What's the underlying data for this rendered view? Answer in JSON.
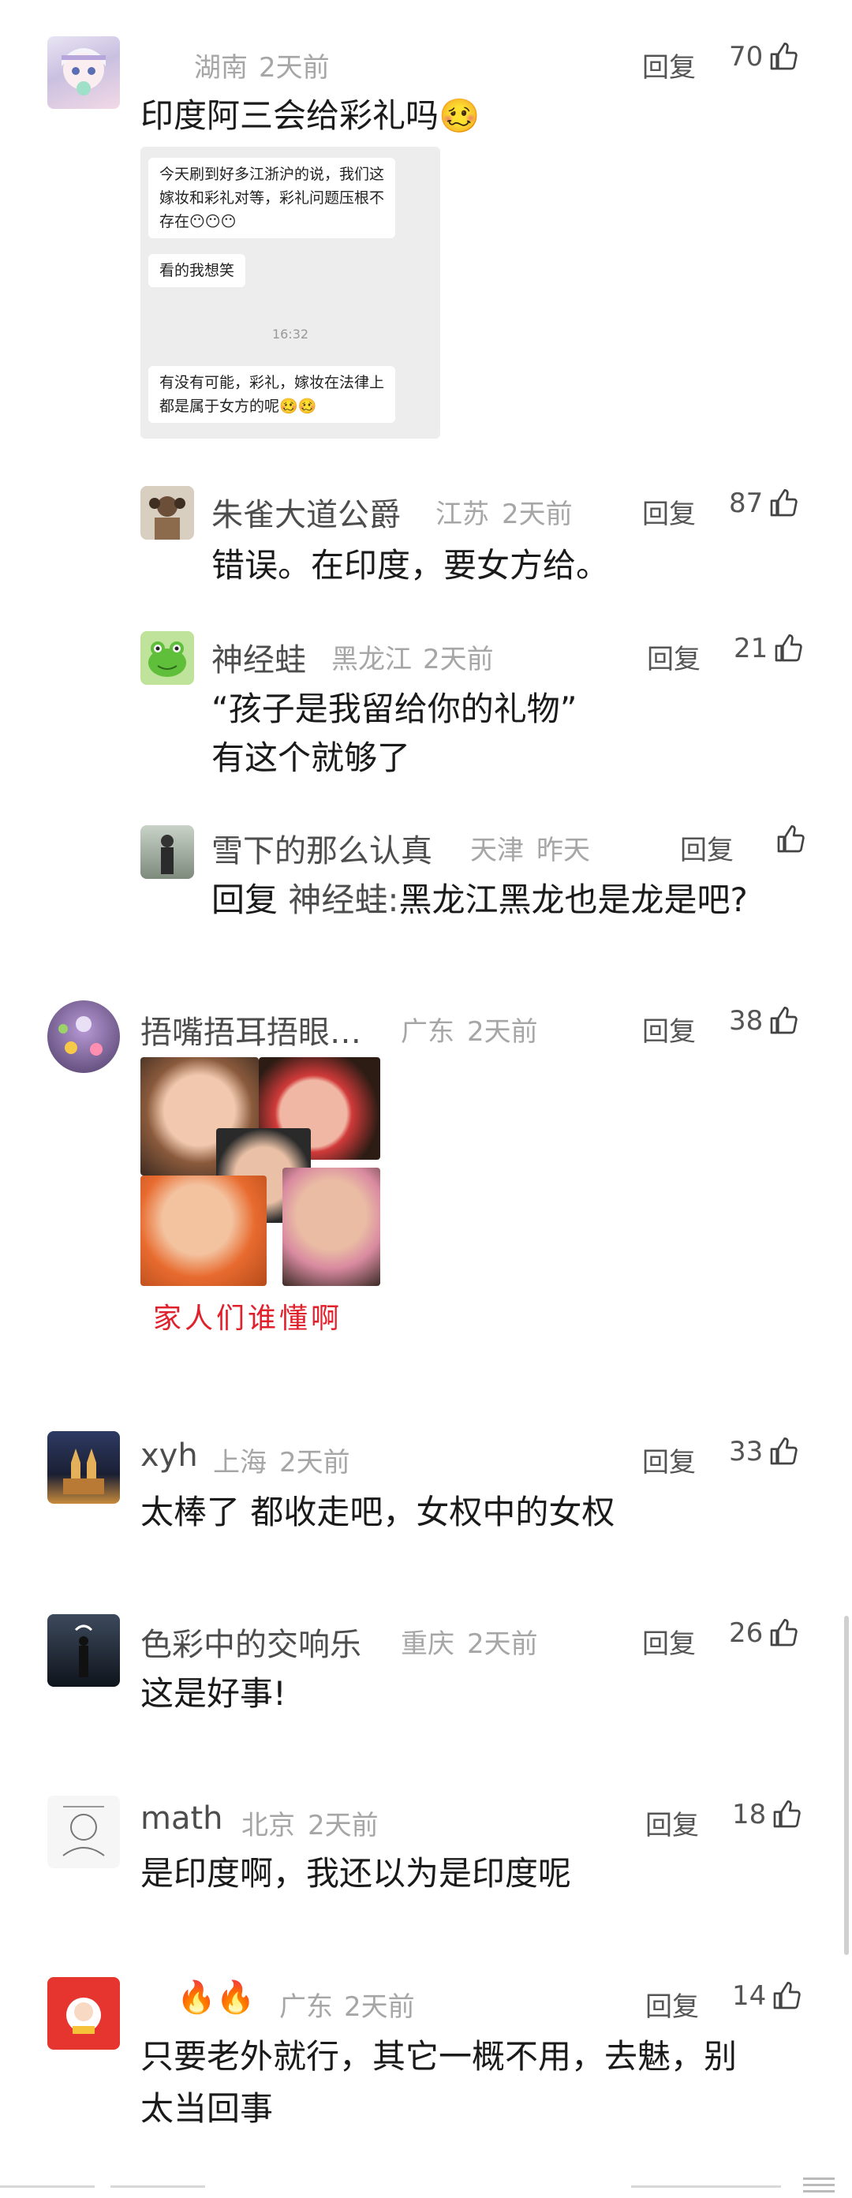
{
  "reply_label": "回复",
  "comments": [
    {
      "name": "",
      "region": "湖南",
      "time": "2天前",
      "likes": "70",
      "text": "印度阿三会给彩礼吗🥴",
      "chat": {
        "bubbles": [
          "今天刷到好多江浙沪的说，我们这",
          "嫁妆和彩礼对等，彩礼问题压根不",
          "存在😶😶😶",
          "看的我想笑",
          "有没有可能，彩礼，嫁妆在法律上",
          "都是属于女方的呢🥴🥴"
        ],
        "time": "16:32"
      }
    },
    {
      "name": "朱雀大道公爵",
      "region": "江苏",
      "time": "2天前",
      "likes": "87",
      "text": "错误。在印度，要女方给。"
    },
    {
      "name": "神经蛙",
      "region": "黑龙江",
      "time": "2天前",
      "likes": "21",
      "lines": [
        "“孩子是我留给你的礼物”",
        "有这个就够了"
      ]
    },
    {
      "name": "雪下的那么认真",
      "region": "天津",
      "time": "昨天",
      "likes": "",
      "reply_prefix": "回复",
      "mention": "神经蛙:",
      "text": "黑龙江黑龙也是龙是吧?"
    },
    {
      "name": "捂嘴捂耳捂眼…",
      "region": "广东",
      "time": "2天前",
      "likes": "38",
      "meme_caption": "家人们谁懂啊"
    },
    {
      "name": "xyh",
      "region": "上海",
      "time": "2天前",
      "likes": "33",
      "text": "太棒了 都收走吧，女权中的女权"
    },
    {
      "name": "色彩中的交响乐",
      "region": "重庆",
      "time": "2天前",
      "likes": "26",
      "text": "这是好事!"
    },
    {
      "name": "math",
      "region": "北京",
      "time": "2天前",
      "likes": "18",
      "text": "是印度啊，我还以为是印度呢"
    },
    {
      "name": "🔥🔥",
      "region": "广东",
      "time": "2天前",
      "likes": "14",
      "lines": [
        "只要老外就行，其它一概不用，去魅，别",
        "太当回事"
      ]
    }
  ]
}
